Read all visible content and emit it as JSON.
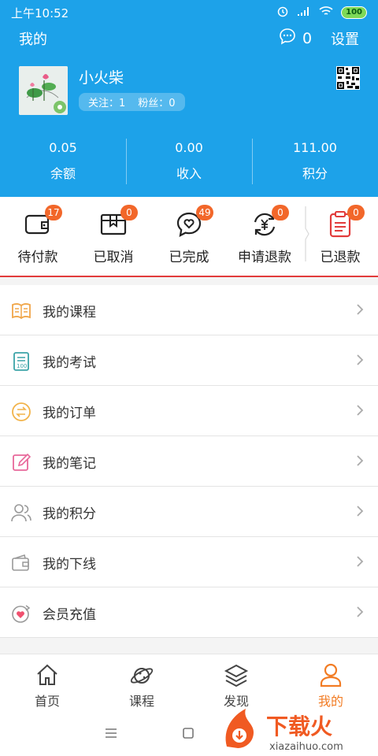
{
  "status_bar": {
    "time": "上午10:52",
    "battery": "100"
  },
  "header": {
    "title": "我的",
    "message_count": "0",
    "settings_label": "设置"
  },
  "profile": {
    "username": "小火柴",
    "following_label": "关注：1",
    "fans_label": "粉丝：0"
  },
  "stats": [
    {
      "value": "0.05",
      "label": "余额"
    },
    {
      "value": "0.00",
      "label": "收入"
    },
    {
      "value": "111.00",
      "label": "积分"
    }
  ],
  "orders": [
    {
      "label": "待付款",
      "badge": "17",
      "icon": "wallet-icon"
    },
    {
      "label": "已取消",
      "badge": "0",
      "icon": "box-icon"
    },
    {
      "label": "已完成",
      "badge": "49",
      "icon": "heart-chat-icon"
    },
    {
      "label": "申请退款",
      "badge": "0",
      "icon": "yen-refresh-icon"
    },
    {
      "label": "已退款",
      "badge": "0",
      "icon": "clipboard-icon"
    }
  ],
  "menu": [
    {
      "label": "我的课程",
      "icon": "book-icon"
    },
    {
      "label": "我的考试",
      "icon": "exam-icon"
    },
    {
      "label": "我的订单",
      "icon": "exchange-icon"
    },
    {
      "label": "我的笔记",
      "icon": "edit-icon"
    },
    {
      "label": "我的积分",
      "icon": "users-icon"
    },
    {
      "label": "我的下线",
      "icon": "wallet-outline-icon"
    },
    {
      "label": "会员充值",
      "icon": "vip-icon"
    }
  ],
  "tabs": [
    {
      "label": "首页",
      "icon": "home-icon"
    },
    {
      "label": "课程",
      "icon": "planet-icon"
    },
    {
      "label": "发现",
      "icon": "layers-icon"
    },
    {
      "label": "我的",
      "icon": "person-icon"
    }
  ],
  "watermark": {
    "brand": "下载火",
    "domain": "xiazaihuo.com"
  },
  "colors": {
    "primary": "#1da2e9",
    "badge": "#f2672a",
    "active_tab": "#f27c24",
    "order_divider": "#e23b3b"
  }
}
